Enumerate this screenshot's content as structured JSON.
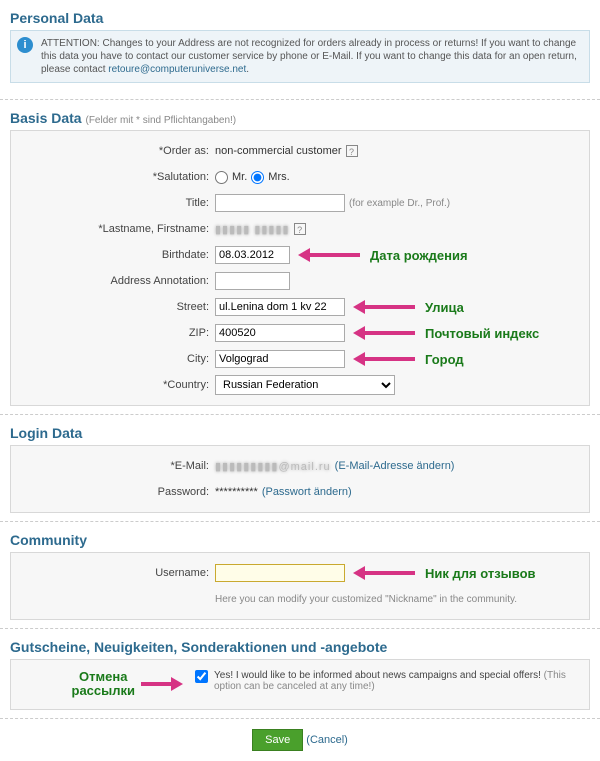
{
  "personal_data": {
    "heading": "Personal Data",
    "attention": "ATTENTION: Changes to your Address are not recognized for orders already in process or returns! If you want to change this data you have to contact our customer service by phone or E-Mail. If you want to change this data for an open return, please contact ",
    "attention_link": "retoure@computeruniverse.net"
  },
  "basis": {
    "heading": "Basis Data",
    "subtitle": "(Felder mit * sind Pflichtangaben!)",
    "order_as": {
      "label": "*Order as:",
      "value": "non-commercial customer"
    },
    "salutation": {
      "label": "*Salutation:",
      "mr": "Mr.",
      "mrs": "Mrs."
    },
    "title": {
      "label": "Title:",
      "hint": "(for example Dr., Prof.)",
      "value": ""
    },
    "name": {
      "label": "*Lastname, Firstname:",
      "value_blur": "▮▮▮▮▮  ▮▮▮▮▮"
    },
    "birthdate": {
      "label": "Birthdate:",
      "value": "08.03.2012",
      "ann": "Дата рождения"
    },
    "address_ann": {
      "label": "Address Annotation:",
      "value": ""
    },
    "street": {
      "label": "Street:",
      "value": "ul.Lenina dom 1 kv 22",
      "ann": "Улица"
    },
    "zip": {
      "label": "ZIP:",
      "value": "400520",
      "ann": "Почтовый индекс"
    },
    "city": {
      "label": "City:",
      "value": "Volgograd",
      "ann": "Город"
    },
    "country": {
      "label": "*Country:",
      "value": "Russian Federation"
    }
  },
  "login": {
    "heading": "Login Data",
    "email": {
      "label": "*E-Mail:",
      "value_blur": "▮▮▮▮▮▮▮▮▮@mail.ru",
      "link": "(E-Mail-Adresse ändern)"
    },
    "password": {
      "label": "Password:",
      "value": "**********",
      "link": "(Passwort ändern)"
    }
  },
  "community": {
    "heading": "Community",
    "username": {
      "label": "Username:",
      "value": "",
      "ann": "Ник для отзывов",
      "hint": "Here you can modify your customized \"Nickname\" in the community."
    }
  },
  "newsletter": {
    "heading": "Gutscheine, Neuigkeiten, Sonderaktionen und -angebote",
    "ann_line1": "Отмена",
    "ann_line2": "рассылки",
    "text": "Yes! I would like to be informed about news campaigns and special offers! ",
    "hint": "(This option can be canceled at any time!)"
  },
  "actions": {
    "save": "Save",
    "cancel": "(Cancel)"
  }
}
